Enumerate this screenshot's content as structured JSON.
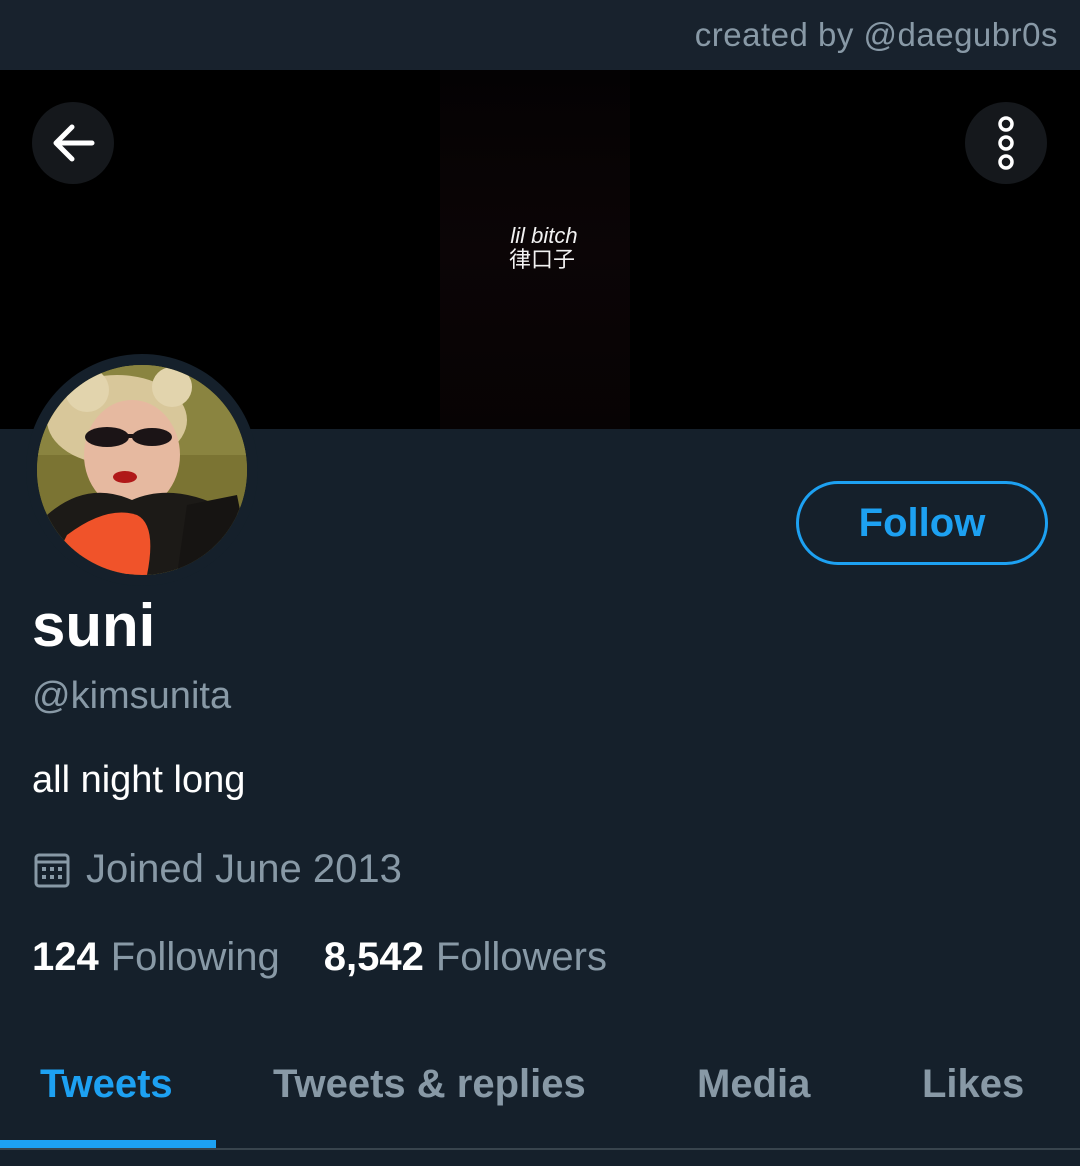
{
  "credit": "created by @daegubr0s",
  "banner": {
    "caption_line1": "lil bitch",
    "caption_line2": "律口子"
  },
  "header": {
    "back_icon": "arrow-left-icon",
    "more_icon": "more-vertical-icon"
  },
  "profile": {
    "display_name": "suni",
    "handle": "@kimsunita",
    "bio": "all night long",
    "joined": "Joined June 2013",
    "follow_label": "Follow",
    "following_count": "124",
    "following_label": "Following",
    "followers_count": "8,542",
    "followers_label": "Followers"
  },
  "tabs": [
    {
      "label": "Tweets",
      "active": true
    },
    {
      "label": "Tweets & replies",
      "active": false
    },
    {
      "label": "Media",
      "active": false
    },
    {
      "label": "Likes",
      "active": false
    }
  ],
  "colors": {
    "background": "#15202b",
    "accent": "#1da1f2",
    "secondary_text": "#8899a6",
    "primary_text": "#ffffff"
  }
}
